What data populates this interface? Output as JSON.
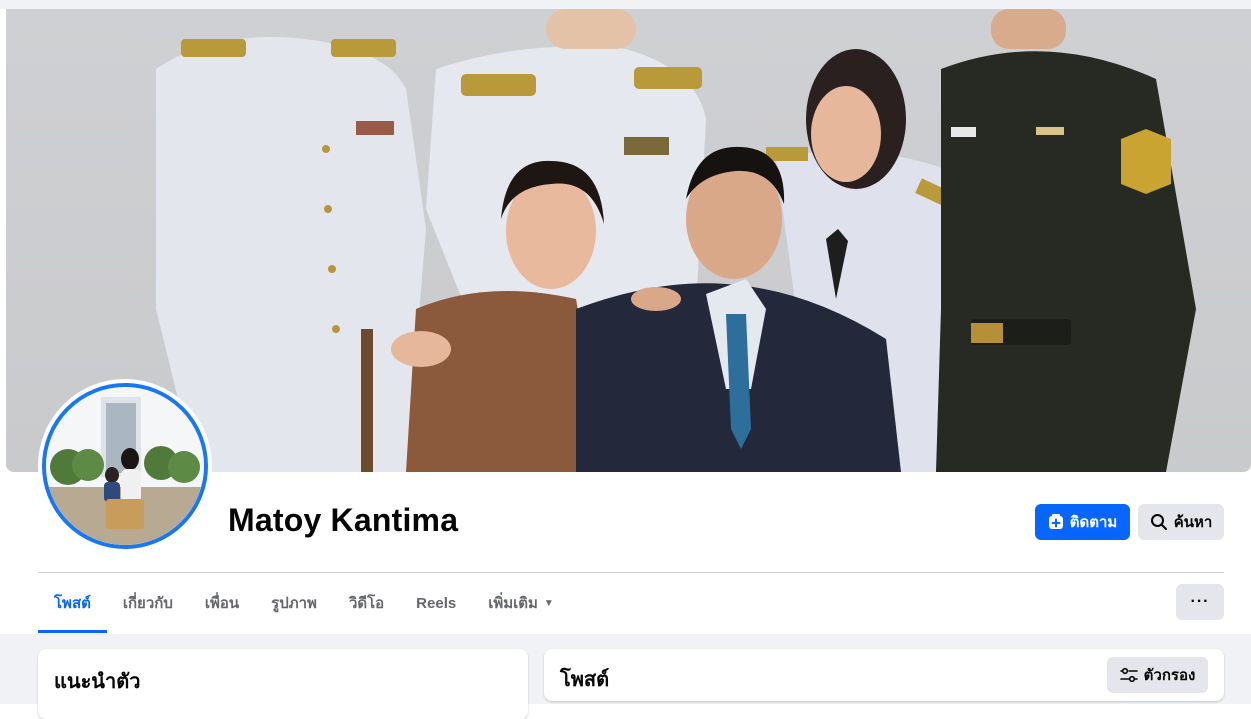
{
  "profile": {
    "name": "Matoy Kantima"
  },
  "actions": {
    "follow_label": "ติดตาม",
    "search_label": "ค้นหา"
  },
  "tabs": [
    {
      "label": "โพสต์",
      "active": true
    },
    {
      "label": "เกี่ยวกับ",
      "active": false
    },
    {
      "label": "เพื่อน",
      "active": false
    },
    {
      "label": "รูปภาพ",
      "active": false
    },
    {
      "label": "วิดีโอ",
      "active": false
    },
    {
      "label": "Reels",
      "active": false
    },
    {
      "label": "เพิ่มเติม",
      "active": false
    }
  ],
  "more_menu_label": "···",
  "intro_card": {
    "title": "แนะนำตัว"
  },
  "posts_card": {
    "title": "โพสต์",
    "filter_label": "ตัวกรอง"
  },
  "colors": {
    "accent": "#0866ff",
    "avatar_ring": "#1877f2",
    "secondary_button": "#e4e6eb",
    "page_background": "#f0f2f5"
  },
  "icons": {
    "follow": "add-follow-icon",
    "search": "search-icon",
    "filter": "filter-sliders-icon",
    "more": "more-dots-icon",
    "dropdown": "chevron-down-icon"
  }
}
